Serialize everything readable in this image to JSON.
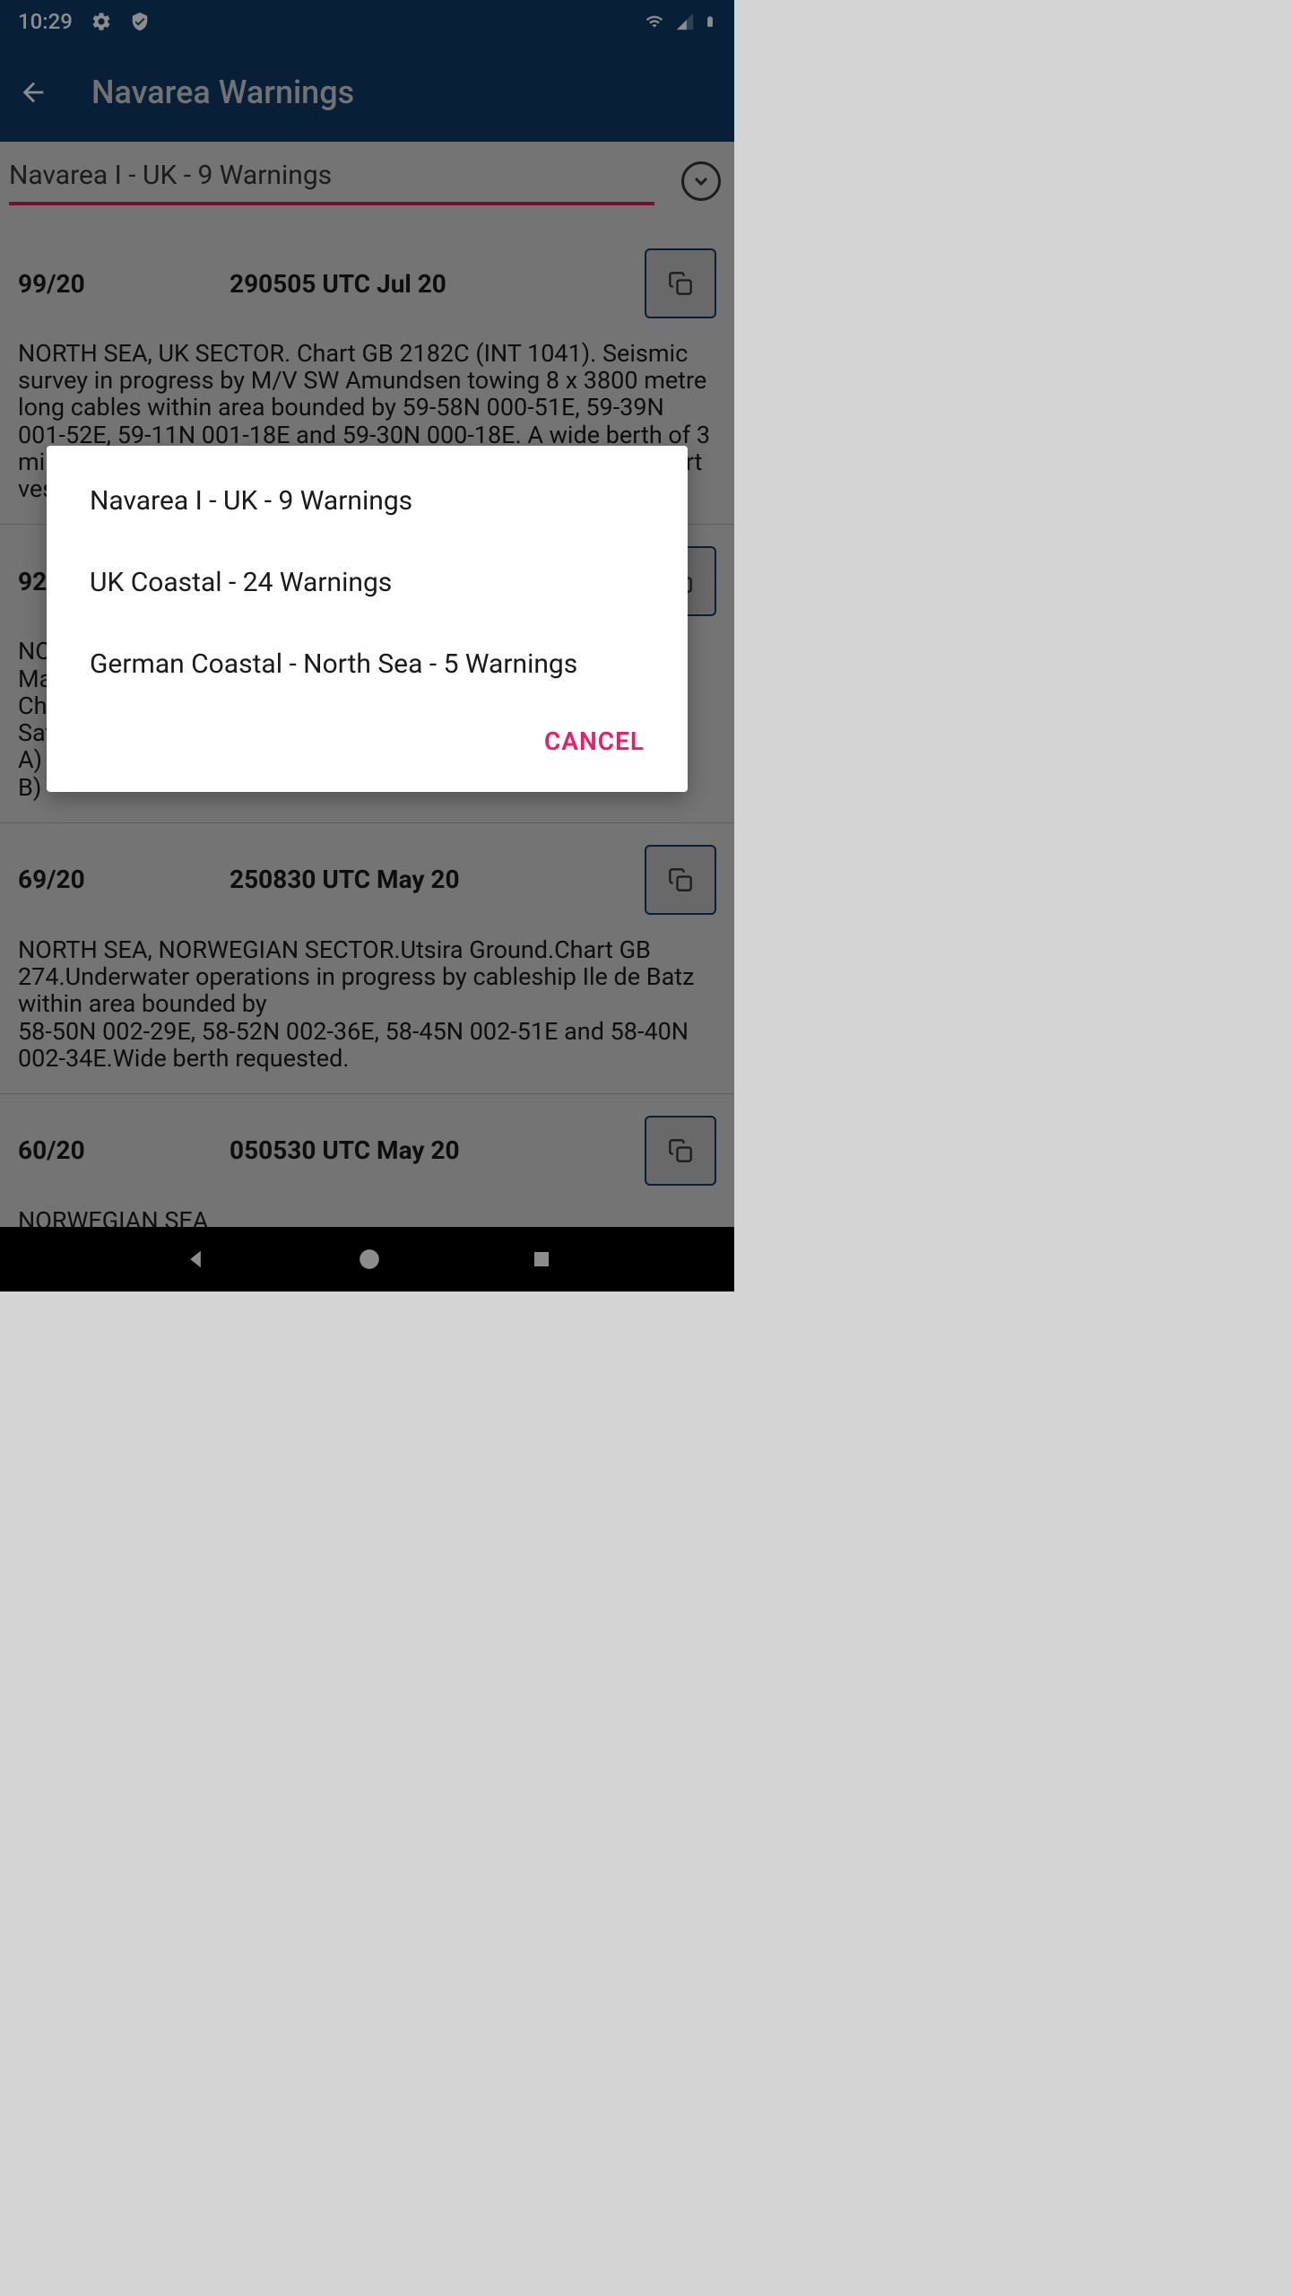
{
  "status": {
    "time": "10:29"
  },
  "appbar": {
    "title": "Navarea Warnings"
  },
  "selector": {
    "label": "Navarea I - UK  -  9 Warnings"
  },
  "warnings": [
    {
      "id": "99/20",
      "date": "290505 UTC Jul 20",
      "body": "NORTH SEA, UK SECTOR.  Chart GB 2182C (INT 1041).  Seismic survey in progress by M/V SW Amundsen towing 8 x 3800 metre long cables within area bounded by 59-58N 000-51E, 59-39N 001-52E, 59-11N 001-18E and 59-30N 000-18E.  A wide berth of 3 miles is requested.  Contact via Aberdeen coastguard or support vessel."
    },
    {
      "id": "92",
      "date": "",
      "body": "NO\nMa\nCh\nSat\nA)\nB)"
    },
    {
      "id": "69/20",
      "date": "250830 UTC May 20",
      "body": "NORTH SEA, NORWEGIAN SECTOR.Utsira Ground.Chart GB 274.Underwater operations in progress by cableship Ile de Batz within area bounded by\n 58-50N 002-29E, 58-52N 002-36E, 58-45N 002-51E and 58-40N 002-34E.Wide berth requested."
    },
    {
      "id": "60/20",
      "date": "050530 UTC May 20",
      "body": "NORWEGIAN SEA"
    }
  ],
  "dialog": {
    "options": [
      "Navarea I - UK  -  9 Warnings",
      "UK Coastal  -  24 Warnings",
      "German Coastal - North Sea  -  5 Warnings"
    ],
    "cancel": "CANCEL"
  }
}
